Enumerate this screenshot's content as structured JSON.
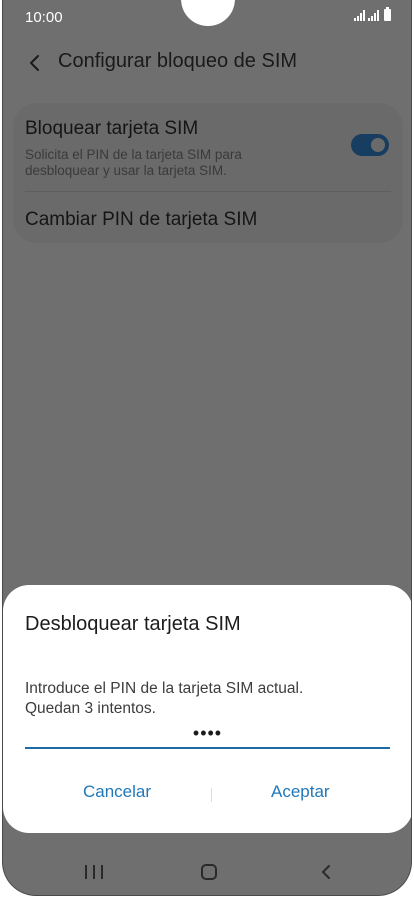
{
  "status_bar": {
    "time": "10:00",
    "icons": [
      "signal-icon",
      "signal-icon",
      "battery-icon"
    ]
  },
  "app_bar": {
    "back_icon": "chevron-left-icon",
    "title": "Configurar bloqueo de SIM"
  },
  "settings": {
    "lock_sim": {
      "title": "Bloquear tarjeta SIM",
      "description": "Solicita el PIN de la tarjeta SIM para desbloquear y usar la tarjeta SIM.",
      "toggle_on": true
    },
    "change_pin": {
      "title": "Cambiar PIN de tarjeta SIM"
    }
  },
  "dialog": {
    "title": "Desbloquear tarjeta SIM",
    "message_line1": "Introduce el PIN de la tarjeta SIM actual.",
    "message_line2": "Quedan 3 intentos.",
    "pin_value": "••••",
    "cancel_label": "Cancelar",
    "accept_label": "Aceptar"
  },
  "nav_bar": {
    "icons": [
      "recent-apps-icon",
      "home-icon",
      "back-icon"
    ]
  },
  "colors": {
    "accent": "#1f78b9",
    "scrim": "#6f6f6f",
    "toggle": "#173d60"
  }
}
